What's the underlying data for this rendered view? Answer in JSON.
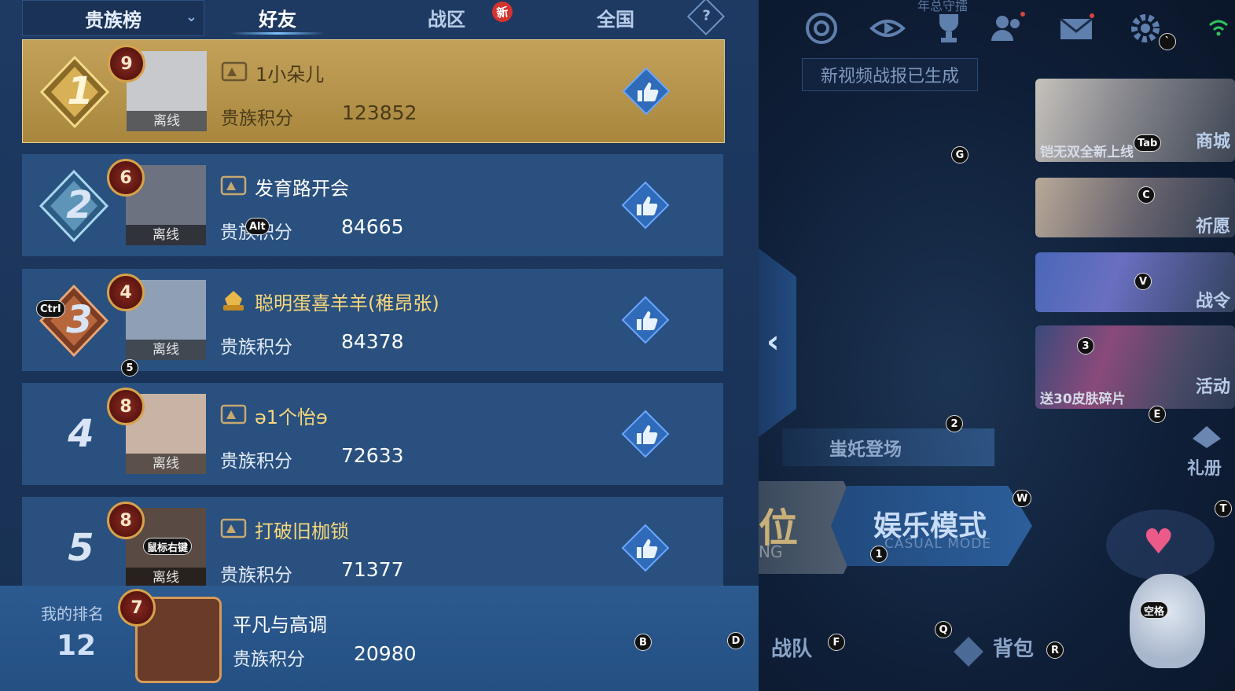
{
  "tabs": {
    "dropdown_label": "贵族榜",
    "friends": "好友",
    "region": "战区",
    "region_badge": "新",
    "national": "全国",
    "help": "?"
  },
  "rows": [
    {
      "rank": "1",
      "level": "9",
      "status": "离线",
      "name": "1小朵儿",
      "score_label": "贵族积分",
      "score": "123852"
    },
    {
      "rank": "2",
      "level": "6",
      "status": "离线",
      "name": "发育路开会",
      "score_label": "贵族积分",
      "score": "84665"
    },
    {
      "rank": "3",
      "level": "4",
      "status": "离线",
      "name": "聪明蛋喜羊羊(稚昂张)",
      "score_label": "贵族积分",
      "score": "84378"
    },
    {
      "rank": "4",
      "level": "8",
      "status": "离线",
      "name": "ə1个怡ɘ",
      "score_label": "贵族积分",
      "score": "72633"
    },
    {
      "rank": "5",
      "level": "8",
      "status": "离线",
      "name": "打破旧枷锁",
      "score_label": "贵族积分",
      "score": "71377"
    }
  ],
  "my_rank": {
    "label": "我的排名",
    "rank": "12",
    "level": "7",
    "name": "平凡与高调",
    "score_label": "贵族积分",
    "score": "20980"
  },
  "right_panel": {
    "top_notice": "新视频战报已生成",
    "top_partial_text": "年总守擂",
    "cards": {
      "shop": {
        "label": "商城",
        "caption": "铠无双全新上线"
      },
      "wish": {
        "label": "祈愿"
      },
      "pass": {
        "label": "战令"
      },
      "event": {
        "label": "活动",
        "caption": "送30皮肤碎片"
      },
      "gift": {
        "label": "礼册"
      }
    },
    "banner_text": "蚩奼登场",
    "rank_mode": {
      "title": "位",
      "subtitle": "NG"
    },
    "fun_mode": {
      "title": "娱乐模式",
      "subtitle": "CASUAL MODE"
    },
    "team": "战队",
    "bag": "背包"
  },
  "key_hints": {
    "k_backtick": "`",
    "k_tab": "Tab",
    "k_g": "G",
    "k_c": "C",
    "k_v": "V",
    "k_3": "3",
    "k_e": "E",
    "k_2": "2",
    "k_w": "W",
    "k_t": "T",
    "k_1": "1",
    "k_space": "空格",
    "k_q": "Q",
    "k_f": "F",
    "k_r": "R",
    "k_alt": "Alt",
    "k_ctrl": "Ctrl",
    "k_5": "5",
    "k_rmb": "鼠标右键",
    "k_b": "B",
    "k_d": "D"
  },
  "colors": {
    "panel_bg": "#1e3a63",
    "row_bg": "#29507e",
    "top_row_gold": "#c3a15a",
    "new_badge": "#d4342f",
    "vip_name": "#f7d77c"
  }
}
